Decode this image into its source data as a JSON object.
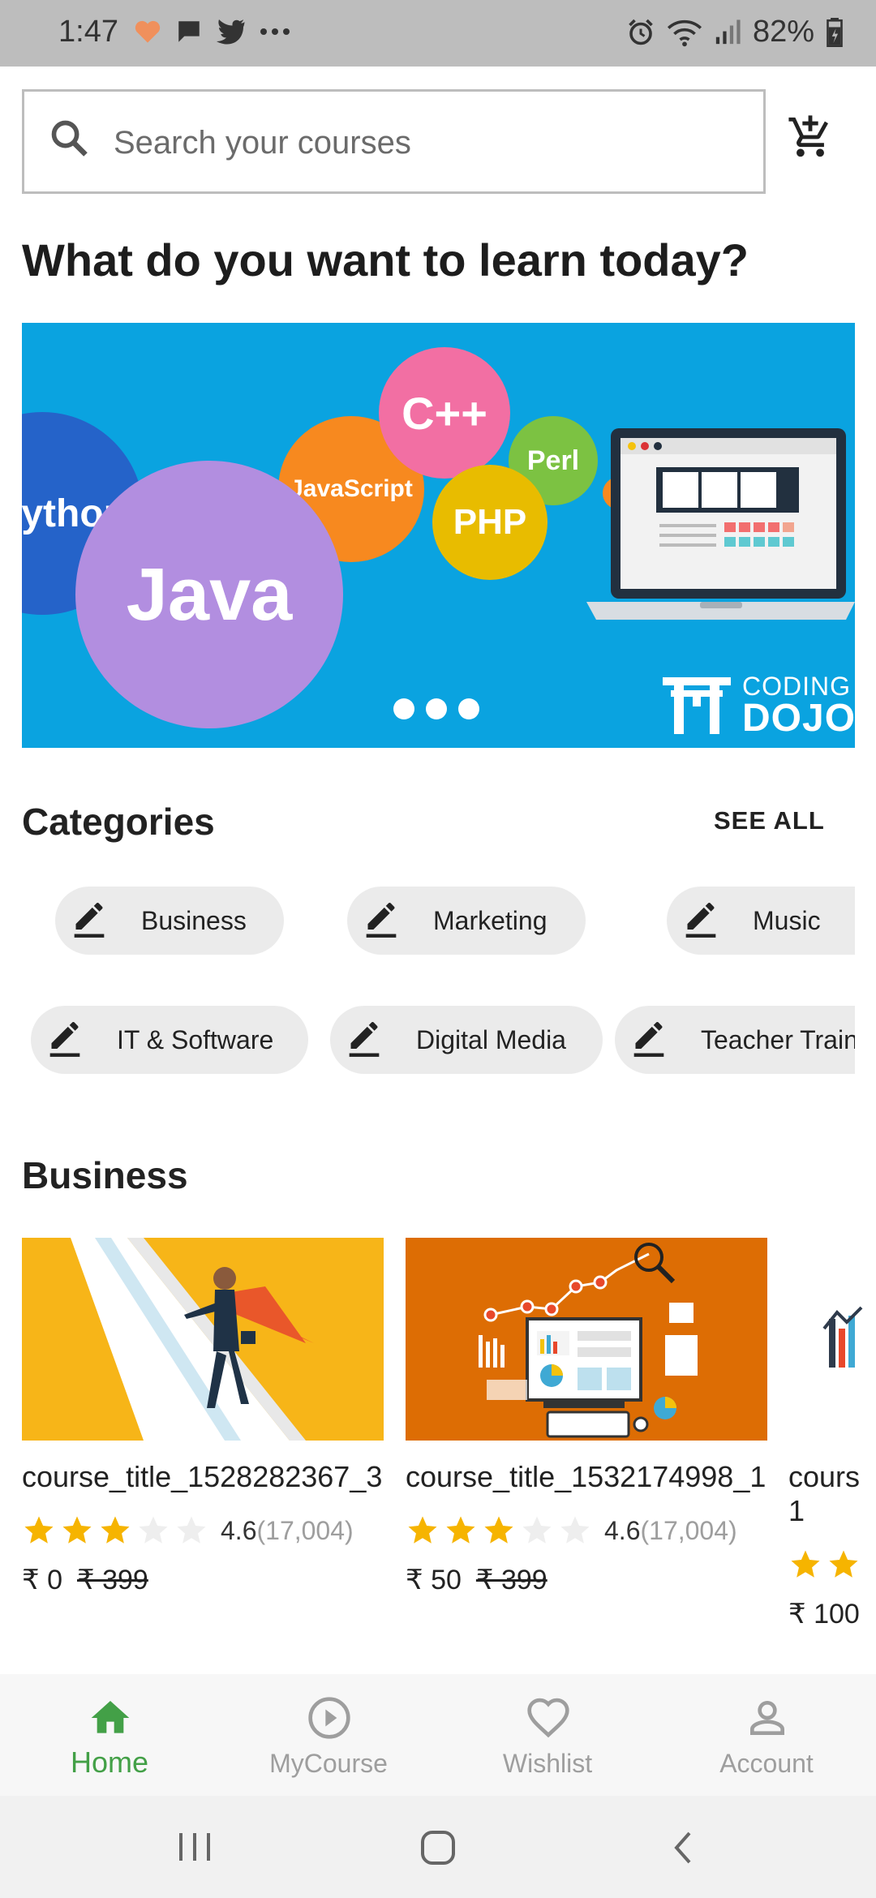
{
  "status_bar": {
    "time": "1:47",
    "battery": "82%"
  },
  "search": {
    "placeholder": "Search your courses"
  },
  "headline": "What do you want to learn today?",
  "banner": {
    "bubbles": [
      "ython",
      "JavaScript",
      "C++",
      "Perl",
      "PHP",
      "Java"
    ],
    "brand_top": "CODING",
    "brand_bottom": "DOJO"
  },
  "categories": {
    "title": "Categories",
    "see_all": "SEE ALL",
    "row1": [
      "Business",
      "Marketing",
      "Music"
    ],
    "row2": [
      "IT & Software",
      "Digital Media",
      "Teacher Train"
    ]
  },
  "business": {
    "title": "Business",
    "courses": [
      {
        "title": "course_title_1528282367_3",
        "rating": "4.6",
        "count": "(17,004)",
        "price": "₹ 0",
        "old_price": "₹ 399",
        "stars_filled": 3
      },
      {
        "title": "course_title_1532174998_1",
        "rating": "4.6",
        "count": "(17,004)",
        "price": "₹ 50",
        "old_price": "₹ 399",
        "stars_filled": 3
      },
      {
        "title": "cours 1",
        "price": "₹ 100",
        "stars_filled": 2
      }
    ]
  },
  "bottom_nav": {
    "items": [
      {
        "label": "Home",
        "icon": "home-icon"
      },
      {
        "label": "MyCourse",
        "icon": "play-circle-icon"
      },
      {
        "label": "Wishlist",
        "icon": "heart-icon"
      },
      {
        "label": "Account",
        "icon": "account-icon"
      }
    ]
  },
  "colors": {
    "accent_green": "#43a047",
    "star_gold": "#f6b400",
    "banner_blue": "#0aa3e0"
  }
}
